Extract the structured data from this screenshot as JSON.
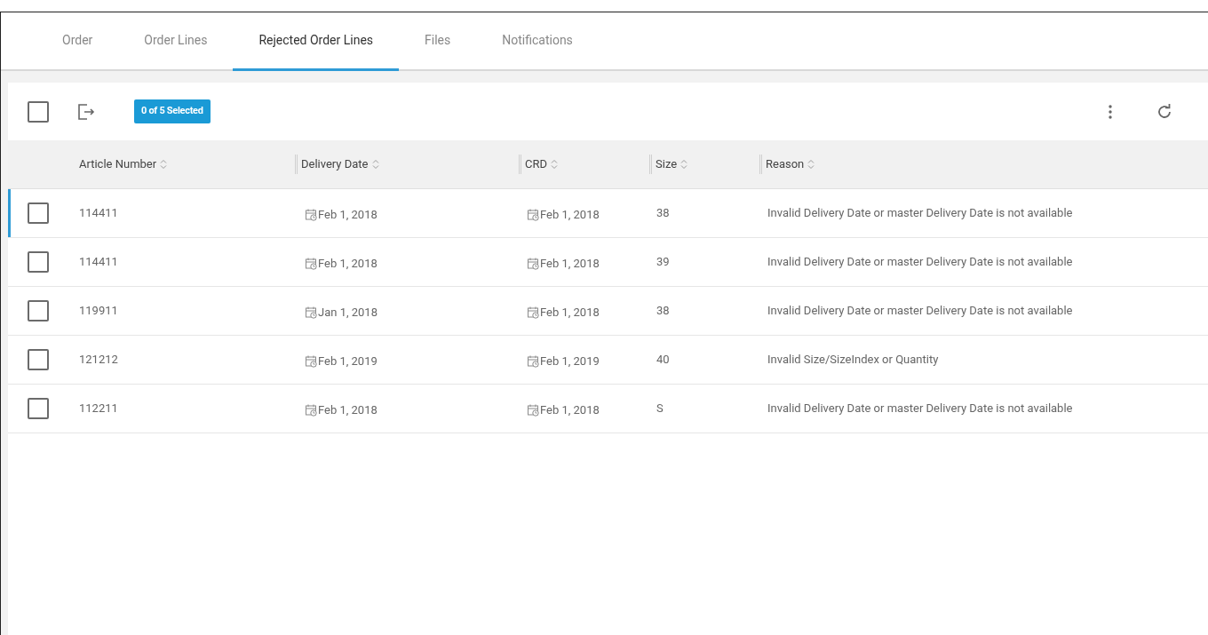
{
  "tabs": [
    {
      "label": "Order",
      "selected": false
    },
    {
      "label": "Order Lines",
      "selected": false
    },
    {
      "label": "Rejected Order Lines",
      "selected": true
    },
    {
      "label": "Files",
      "selected": false
    },
    {
      "label": "Notifications",
      "selected": false
    }
  ],
  "toolbar": {
    "select_all_checked": false,
    "selection_badge": "0 of 5 Selected"
  },
  "table": {
    "columns": [
      "Article Number",
      "Delivery Date",
      "CRD",
      "Size",
      "Reason"
    ],
    "rows": [
      {
        "checked": false,
        "focused": true,
        "article": "114411",
        "delivery_date": "Feb 1, 2018",
        "crd": "Feb 1, 2018",
        "size": "38",
        "reason": "Invalid Delivery Date or master Delivery Date is not available"
      },
      {
        "checked": false,
        "focused": false,
        "article": "114411",
        "delivery_date": "Feb 1, 2018",
        "crd": "Feb 1, 2018",
        "size": "39",
        "reason": "Invalid Delivery Date or master Delivery Date is not available"
      },
      {
        "checked": false,
        "focused": false,
        "article": "119911",
        "delivery_date": "Jan 1, 2018",
        "crd": "Feb 1, 2018",
        "size": "38",
        "reason": "Invalid Delivery Date or master Delivery Date is not available"
      },
      {
        "checked": false,
        "focused": false,
        "article": "121212",
        "delivery_date": "Feb 1, 2019",
        "crd": "Feb 1, 2019",
        "size": "40",
        "reason": "Invalid Size/SizeIndex or Quantity"
      },
      {
        "checked": false,
        "focused": false,
        "article": "112211",
        "delivery_date": "Feb 1, 2018",
        "crd": "Feb 1, 2018",
        "size": "S",
        "reason": "Invalid Delivery Date or master Delivery Date is not available"
      }
    ]
  }
}
